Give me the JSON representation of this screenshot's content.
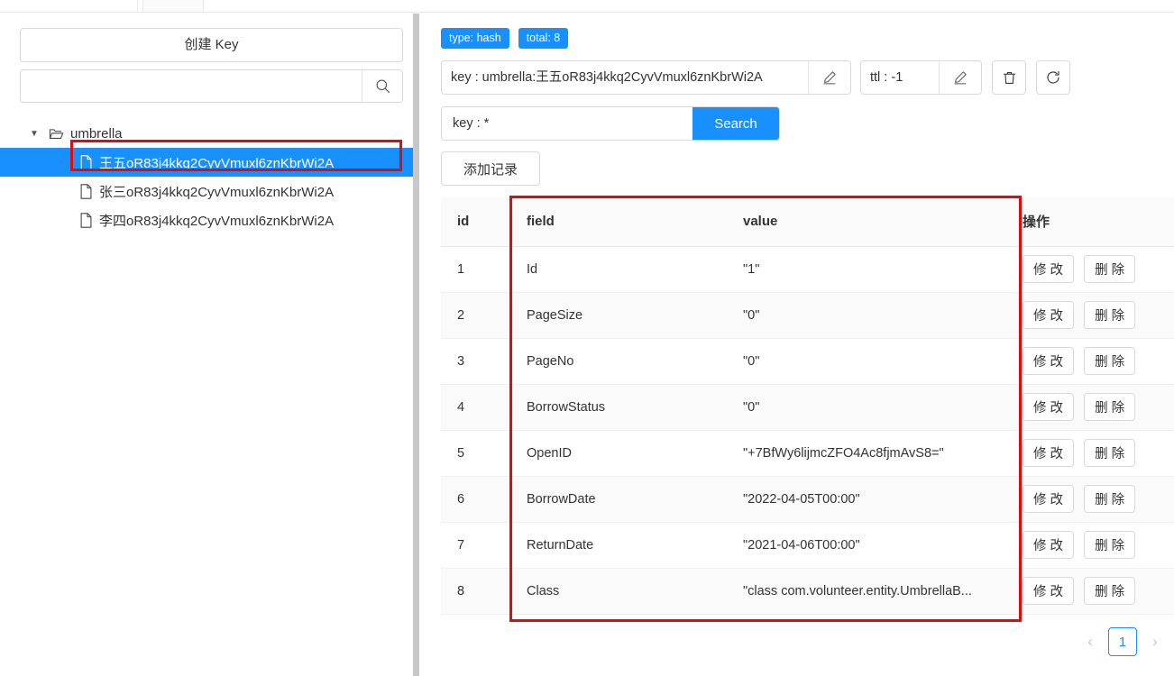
{
  "colors": {
    "accent": "#1890ff",
    "annotation": "#e00c0c",
    "border": "#d9d9d9",
    "header_bg": "#fafafa"
  },
  "sidebar": {
    "create_key_label": "创建 Key",
    "search": {
      "value": "",
      "placeholder": "",
      "icon": "search-icon"
    },
    "tree": {
      "root": {
        "label": "umbrella",
        "icon": "folder-open-icon",
        "caret": "▼",
        "expanded": true
      },
      "children": [
        {
          "label": "王五oR83j4kkq2CyvVmuxl6znKbrWi2A",
          "icon": "file-icon",
          "selected": true
        },
        {
          "label": "张三oR83j4kkq2CyvVmuxl6znKbrWi2A",
          "icon": "file-icon",
          "selected": false
        },
        {
          "label": "李四oR83j4kkq2CyvVmuxl6znKbrWi2A",
          "icon": "file-icon",
          "selected": false
        }
      ]
    }
  },
  "main": {
    "tags": [
      {
        "label": "type: hash",
        "color": "#1890ff"
      },
      {
        "label": "total: 8",
        "color": "#1890ff"
      }
    ],
    "key_field": {
      "text": "key : umbrella:王五oR83j4kkq2CyvVmuxl6znKbrWi2A",
      "edit_icon": "pencil-icon"
    },
    "ttl_field": {
      "text": "ttl : -1",
      "edit_icon": "pencil-icon"
    },
    "delete_button": {
      "icon": "trash-icon"
    },
    "refresh_button": {
      "icon": "refresh-icon"
    },
    "search": {
      "value": "key : *",
      "placeholder": "key : *",
      "button_label": "Search"
    },
    "add_record_label": "添加记录",
    "table": {
      "columns": [
        "id",
        "field",
        "value",
        "操作"
      ],
      "rows": [
        {
          "id": "1",
          "field": "Id",
          "value": "\"1\""
        },
        {
          "id": "2",
          "field": "PageSize",
          "value": "\"0\""
        },
        {
          "id": "3",
          "field": "PageNo",
          "value": "\"0\""
        },
        {
          "id": "4",
          "field": "BorrowStatus",
          "value": "\"0\""
        },
        {
          "id": "5",
          "field": "OpenID",
          "value": "\"+7BfWy6lijmcZFO4Ac8fjmAvS8=\""
        },
        {
          "id": "6",
          "field": "BorrowDate",
          "value": "\"2022-04-05T00:00\""
        },
        {
          "id": "7",
          "field": "ReturnDate",
          "value": "\"2021-04-06T00:00\""
        },
        {
          "id": "8",
          "field": "Class",
          "value": "\"class com.volunteer.entity.UmbrellaB..."
        }
      ],
      "op_edit_label": "修 改",
      "op_delete_label": "删 除"
    },
    "pagination": {
      "prev": "‹",
      "next": "›",
      "current_page": "1"
    }
  }
}
